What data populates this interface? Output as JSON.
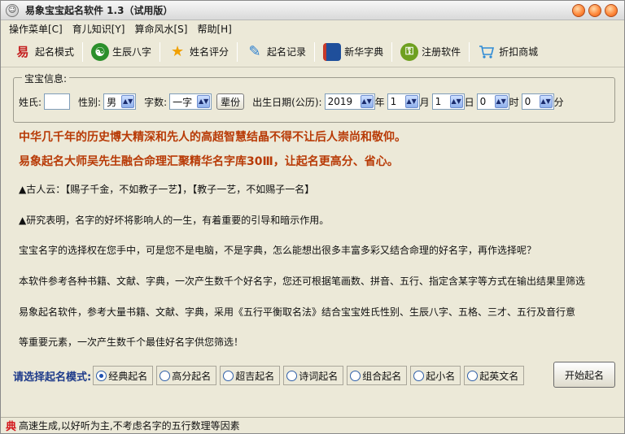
{
  "window": {
    "title": "易象宝宝起名软件 1.3（试用版）"
  },
  "menu": [
    {
      "label": "操作菜单[C]"
    },
    {
      "label": "育儿知识[Y]"
    },
    {
      "label": "算命风水[S]"
    },
    {
      "label": "帮助[H]"
    }
  ],
  "toolbar": [
    {
      "label": "起名模式",
      "icon": "brush-icon",
      "glyph": "易",
      "color": "#c42121"
    },
    {
      "label": "生辰八字",
      "icon": "yin-yang-icon",
      "glyph": "☯",
      "color": "#2b8f2b"
    },
    {
      "label": "姓名评分",
      "icon": "star-icon",
      "glyph": "★",
      "color": "#f0a000"
    },
    {
      "label": "起名记录",
      "icon": "pen-icon",
      "glyph": "✎",
      "color": "#2a7fd0"
    },
    {
      "label": "新华字典",
      "icon": "book-icon",
      "glyph": "▮",
      "color": "#1f4f9b"
    },
    {
      "label": "注册软件",
      "icon": "key-icon",
      "glyph": "⚿",
      "color": "#6ea020"
    },
    {
      "label": "折扣商城",
      "icon": "cart-icon",
      "glyph": "🛒",
      "color": "#2d8ad6"
    }
  ],
  "info": {
    "legend": "宝宝信息:",
    "surname_label": "姓氏:",
    "surname_value": "",
    "gender_label": "性别:",
    "gender_value": "男",
    "chars_label": "字数:",
    "chars_value": "一字",
    "generation_button": "辈份",
    "birth_label": "出生日期(公历):",
    "year_value": "2019",
    "year_unit": "年",
    "month_value": "1",
    "month_unit": "月",
    "day_value": "1",
    "day_unit": "日",
    "hour_value": "0",
    "hour_unit": "时",
    "minute_value": "0",
    "minute_unit": "分"
  },
  "content": {
    "headline1": "中华几千年的历史博大精深和先人的高超智慧结晶不得不让后人崇尚和敬仰。",
    "headline2": "易象起名大师吴先生融合命理汇聚精华名字库30Ⅲ，让起名更高分、省心。",
    "para1": "▲古人云：【赐子千金，不如教子一艺】，【教子一艺，不如赐子一名】",
    "para2": "▲研究表明，名字的好坏将影响人的一生，有着重要的引导和暗示作用。",
    "para3": "宝宝名字的选择权在您手中，可是您不是电脑，不是字典，怎么能想出很多丰富多彩又结合命理的好名字，再作选择呢？",
    "para4": "本软件参考各种书籍、文献、字典，一次产生数千个好名字，您还可根据笔画数、拼音、五行、指定含某字等方式在输出结果里筛选",
    "para5": "易象起名软件，参考大量书籍、文献、字典，采用《五行平衡取名法》结合宝宝姓氏性别、生辰八字、五格、三才、五行及音行意",
    "para6": "等重要元素，一次产生数千个最佳好名字供您筛选！"
  },
  "mode": {
    "title": "请选择起名模式:",
    "options": [
      {
        "label": "经典起名",
        "checked": true
      },
      {
        "label": "高分起名",
        "checked": false
      },
      {
        "label": "超吉起名",
        "checked": false
      },
      {
        "label": "诗词起名",
        "checked": false
      },
      {
        "label": "组合起名",
        "checked": false
      },
      {
        "label": "起小名",
        "checked": false
      },
      {
        "label": "起英文名",
        "checked": false
      }
    ],
    "start_button": "开始起名"
  },
  "status": {
    "icon_glyph": "典",
    "text": "高速生成,以好听为主,不考虑名字的五行数理等因素"
  }
}
